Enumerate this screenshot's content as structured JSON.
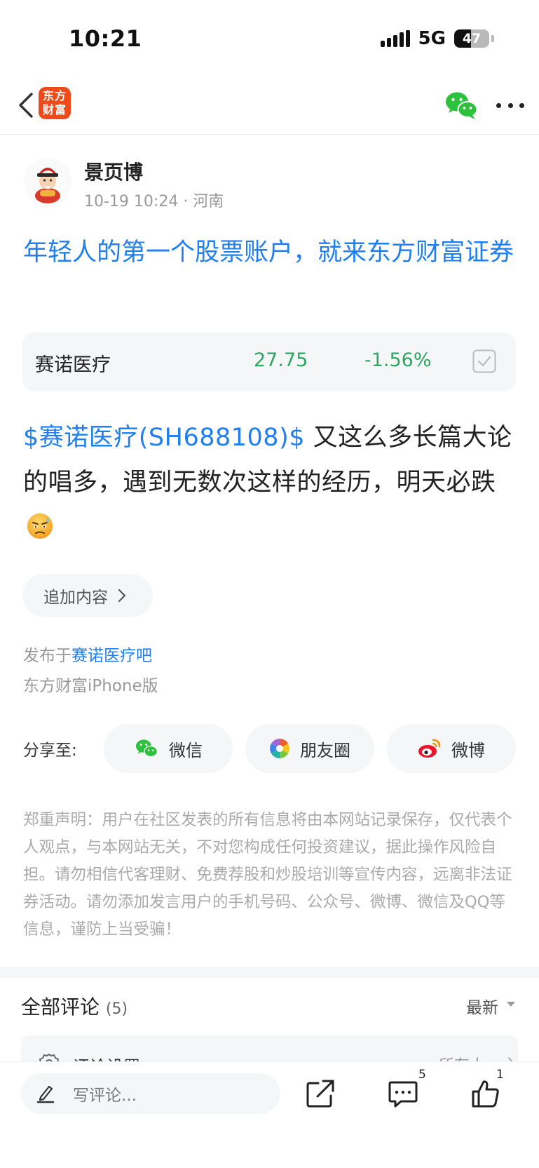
{
  "status_bar": {
    "time": "10:21",
    "network": "5G",
    "battery": "47",
    "battery_level": 0.47
  },
  "nav": {
    "logo_line1": "东方",
    "logo_line2": "财富"
  },
  "author": {
    "name": "景页博",
    "meta": "10-19 10:24 · 河南"
  },
  "post": {
    "title": "年轻人的第一个股票账户，就来东方财富证券",
    "stock_card": {
      "name": "赛诺医疗",
      "price": "27.75",
      "change": "-1.56%"
    },
    "body_tag": "$赛诺医疗(SH688108)$",
    "body_text": " 又这么多长篇大论的唱多，遇到无数次这样的经历，明天必跌",
    "append_label": "追加内容",
    "published_prefix": "发布于",
    "published_bar": "赛诺医疗吧",
    "client": "东方财富iPhone版"
  },
  "share": {
    "label": "分享至:",
    "wechat": "微信",
    "moments": "朋友圈",
    "weibo": "微博"
  },
  "disclaimer": "郑重声明：用户在社区发表的所有信息将由本网站记录保存，仅代表个人观点，与本网站无关，不对您构成任何投资建议，据此操作风险自担。请勿相信代客理财、免费荐股和炒股培训等宣传内容，远离非法证券活动。请勿添加发言用户的手机号码、公众号、微博、微信及QQ等信息，谨防上当受骗！",
  "comments": {
    "title": "全部评论",
    "count": "(5)",
    "sort": "最新",
    "settings_label": "评论设置",
    "settings_value": "所有人"
  },
  "bottom_bar": {
    "input_placeholder": "写评论...",
    "comment_count": "5",
    "like_count": "1"
  },
  "colors": {
    "link_blue": "#1f7ff0",
    "down_green": "#2ea660",
    "brand_orange": "#ef4a19"
  }
}
